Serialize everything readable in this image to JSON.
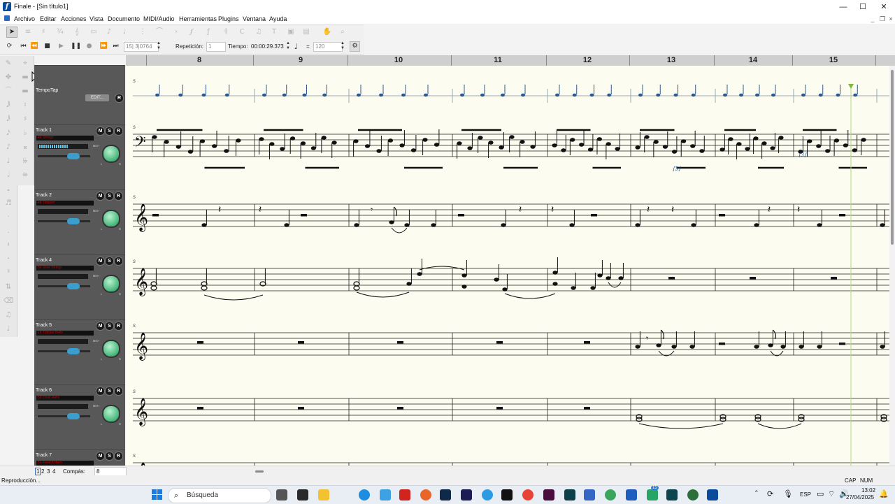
{
  "window": {
    "title": "Finale - [Sin título1]"
  },
  "menu": [
    "Archivo",
    "Editar",
    "Acciones",
    "Vista",
    "Documento",
    "MIDI/Audio",
    "Herramientas",
    "Plugins",
    "Ventana",
    "Ayuda"
  ],
  "playback": {
    "counter": "15| 3|0764",
    "repeat_label": "Repetición:",
    "repeat_value": "1",
    "time_label": "Tiempo:",
    "time_value": "00:00:29.373",
    "equals": "=",
    "tempo_value": "120"
  },
  "ruler": {
    "measures": [
      "8",
      "9",
      "10",
      "11",
      "12",
      "13",
      "14",
      "15"
    ]
  },
  "tempotap": {
    "name": "TempoTap",
    "edit_label": "EDIT...",
    "r_label": "R"
  },
  "tracks": [
    {
      "name": "Track 1",
      "instrument": "49 Strings"
    },
    {
      "name": "Track 2",
      "instrument": "48 Timpani"
    },
    {
      "name": "Track 4",
      "instrument": "50 Slow Strings"
    },
    {
      "name": "Track 5",
      "instrument": "15 Tubular Bells"
    },
    {
      "name": "Track 6",
      "instrument": "53 Choir Aahs"
    },
    {
      "name": "Track 7",
      "instrument": "61 French Horn"
    }
  ],
  "mixer_labels": {
    "m": "M",
    "s": "S",
    "r": "R",
    "mix": "MIX+",
    "l": "L",
    "rr": "R"
  },
  "bottom": {
    "pages": [
      "1",
      "2",
      "3",
      "4"
    ],
    "measure_label": "Compás:",
    "measure_value": "8"
  },
  "status": {
    "text": "Reproducción...",
    "cap": "CAP",
    "num": "NUM"
  },
  "taskbar": {
    "search": "Búsqueda",
    "lang": "ESP",
    "time": "13:02",
    "date": "27/04/2025",
    "badge": "15"
  }
}
